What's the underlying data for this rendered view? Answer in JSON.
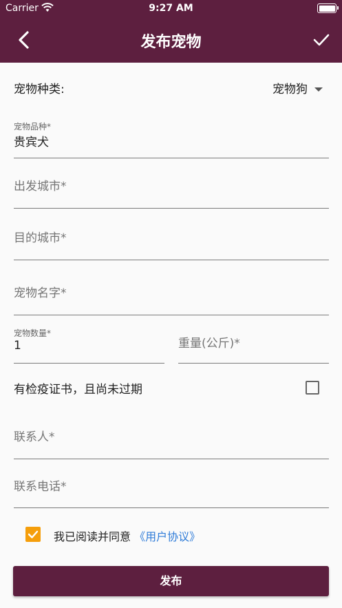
{
  "status_bar": {
    "carrier": "Carrier",
    "time": "9:27 AM"
  },
  "appbar": {
    "title": "发布宠物"
  },
  "form": {
    "pet_type": {
      "label": "宠物种类:",
      "value": "宠物狗"
    },
    "breed": {
      "label": "宠物品种*",
      "value": "贵宾犬"
    },
    "departure_city": {
      "placeholder": "出发城市*"
    },
    "destination_city": {
      "placeholder": "目的城市*"
    },
    "pet_name": {
      "placeholder": "宠物名字*"
    },
    "pet_quantity": {
      "label": "宠物数量*",
      "value": "1"
    },
    "weight": {
      "placeholder": "重量(公斤)*"
    },
    "quarantine": {
      "label": "有检疫证书，且尚未过期",
      "checked": false
    },
    "contact_person": {
      "placeholder": "联系人*"
    },
    "contact_phone": {
      "placeholder": "联系电话*"
    }
  },
  "agreement": {
    "text": "我已阅读并同意",
    "link": "《用户协议》",
    "checked": true
  },
  "submit_label": "发布",
  "colors": {
    "primary": "#5d1f3f",
    "checkbox_accent": "#f59e0b",
    "link": "#2e7bd8"
  }
}
